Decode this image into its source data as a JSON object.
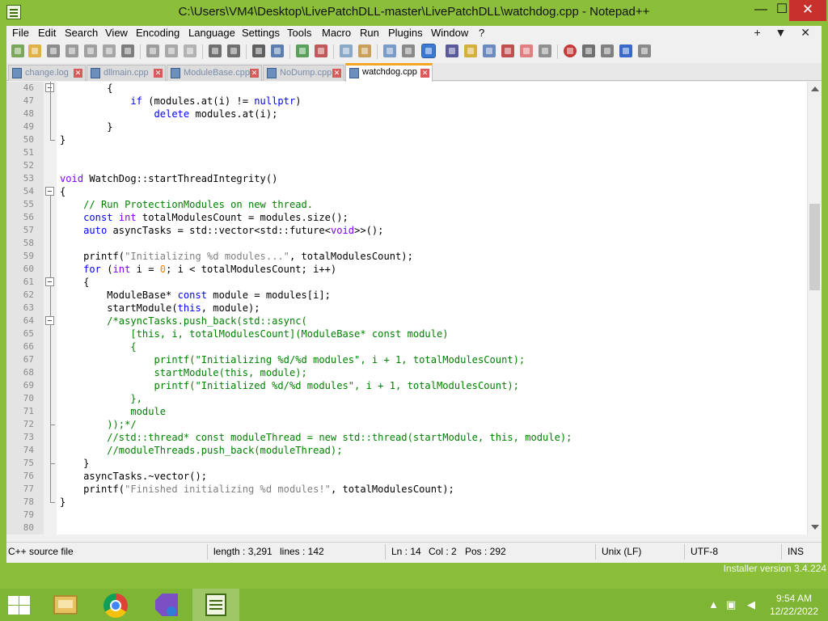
{
  "window": {
    "title": "C:\\Users\\VM4\\Desktop\\LivePatchDLL-master\\LivePatchDLL\\watchdog.cpp - Notepad++",
    "minimize": "—",
    "maximize": "☐",
    "close": "✕"
  },
  "menu": {
    "items": [
      "File",
      "Edit",
      "Search",
      "View",
      "Encoding",
      "Language",
      "Settings",
      "Tools",
      "Macro",
      "Run",
      "Plugins",
      "Window",
      "?"
    ],
    "extra_plus": "+",
    "extra_dropdown": "▼",
    "extra_close": "✕"
  },
  "toolbar": {
    "icons": [
      "new-file-icon",
      "open-file-icon",
      "save-icon",
      "save-all-icon",
      "close-icon",
      "close-all-icon",
      "print-icon",
      "cut-icon",
      "copy-icon",
      "paste-icon",
      "undo-icon",
      "redo-icon",
      "find-icon",
      "replace-icon",
      "zoom-in-icon",
      "zoom-out-icon",
      "sync-vertical-icon",
      "sync-horizontal-icon",
      "word-wrap-icon",
      "show-all-chars-icon",
      "indent-guide-icon",
      "user-language-icon",
      "doc-map-icon",
      "function-list-icon",
      "folder-as-workspace-icon",
      "monitoring-icon",
      "record-macro-icon",
      "stop-macro-icon",
      "play-macro-icon",
      "run-macro-multiple-icon",
      "save-macro-icon"
    ]
  },
  "tabs": [
    {
      "label": "change.log",
      "active": false
    },
    {
      "label": "dllmain.cpp",
      "active": false
    },
    {
      "label": "ModuleBase.cpp",
      "active": false
    },
    {
      "label": "NoDump.cpp",
      "active": false
    },
    {
      "label": "watchdog.cpp",
      "active": true
    }
  ],
  "editor": {
    "lines": [
      {
        "n": "46",
        "html": "        {"
      },
      {
        "n": "47",
        "html": "            <span class=\"kw\">if</span> (modules.at(i) != <span class=\"kw\">nullptr</span>)"
      },
      {
        "n": "48",
        "html": "                <span class=\"kw\">delete</span> modules.at(i);"
      },
      {
        "n": "49",
        "html": "        }"
      },
      {
        "n": "50",
        "html": "}"
      },
      {
        "n": "51",
        "html": ""
      },
      {
        "n": "52",
        "html": ""
      },
      {
        "n": "53",
        "html": "<span class=\"ty\">void</span> WatchDog::startThreadIntegrity()"
      },
      {
        "n": "54",
        "html": "{"
      },
      {
        "n": "55",
        "html": "    <span class=\"cm\">// Run ProtectionModules on new thread.</span>"
      },
      {
        "n": "56",
        "html": "    <span class=\"kw\">const</span> <span class=\"ty\">int</span> totalModulesCount = modules.size();"
      },
      {
        "n": "57",
        "html": "    <span class=\"kw\">auto</span> asyncTasks = std::vector&lt;std::future&lt;<span class=\"ty\">void</span>&gt;&gt;();"
      },
      {
        "n": "58",
        "html": ""
      },
      {
        "n": "59",
        "html": "    printf(<span class=\"st\">\"Initializing %d modules...\"</span>, totalModulesCount);"
      },
      {
        "n": "60",
        "html": "    <span class=\"kw\">for</span> (<span class=\"ty\">int</span> i = <span class=\"nm\">0</span>; i &lt; totalModulesCount; i++)"
      },
      {
        "n": "61",
        "html": "    {"
      },
      {
        "n": "62",
        "html": "        ModuleBase* <span class=\"kw\">const</span> module = modules[i];"
      },
      {
        "n": "63",
        "html": "        startModule(<span class=\"kw\">this</span>, module);"
      },
      {
        "n": "64",
        "html": "        <span class=\"cm\">/*asyncTasks.push_back(std::async(</span>"
      },
      {
        "n": "65",
        "html": "<span class=\"cm\">            [this, i, totalModulesCount](ModuleBase* const module)</span>"
      },
      {
        "n": "66",
        "html": "<span class=\"cm\">            {</span>"
      },
      {
        "n": "67",
        "html": "<span class=\"cm\">                printf(\"Initializing %d/%d modules\", i + 1, totalModulesCount);</span>"
      },
      {
        "n": "68",
        "html": "<span class=\"cm\">                startModule(this, module);</span>"
      },
      {
        "n": "69",
        "html": "<span class=\"cm\">                printf(\"Initialized %d/%d modules\", i + 1, totalModulesCount);</span>"
      },
      {
        "n": "70",
        "html": "<span class=\"cm\">            },</span>"
      },
      {
        "n": "71",
        "html": "<span class=\"cm\">            module</span>"
      },
      {
        "n": "72",
        "html": "<span class=\"cm\">        ));*/</span>"
      },
      {
        "n": "73",
        "html": "        <span class=\"cm\">//std::thread* const moduleThread = new std::thread(startModule, this, module);</span>"
      },
      {
        "n": "74",
        "html": "        <span class=\"cm\">//moduleThreads.push_back(moduleThread);</span>"
      },
      {
        "n": "75",
        "html": "    }"
      },
      {
        "n": "76",
        "html": "    asyncTasks.~vector();"
      },
      {
        "n": "77",
        "html": "    printf(<span class=\"st\">\"Finished initializing %d modules!\"</span>, totalModulesCount);"
      },
      {
        "n": "78",
        "html": "}"
      },
      {
        "n": "79",
        "html": ""
      },
      {
        "n": "80",
        "html": ""
      }
    ]
  },
  "status": {
    "file_type": "C++ source file",
    "length": "length : 3,291",
    "lines": "lines : 142",
    "ln": "Ln : 14",
    "col": "Col : 2",
    "pos": "Pos : 292",
    "eol": "Unix (LF)",
    "encoding": "UTF-8",
    "mode": "INS"
  },
  "desktop": {
    "installer_version": "Installer version 3.4.224"
  },
  "taskbar": {
    "items": [
      "file-explorer-icon",
      "chrome-icon",
      "visual-studio-installer-icon",
      "notepad-plus-plus-icon"
    ],
    "time": "9:54 AM",
    "date": "12/22/2022"
  },
  "colors": {
    "accent": "#8bbf3a",
    "taskbar": "#7fb535",
    "close_button": "#c7302b",
    "active_tab_marker": "#f5a623"
  }
}
